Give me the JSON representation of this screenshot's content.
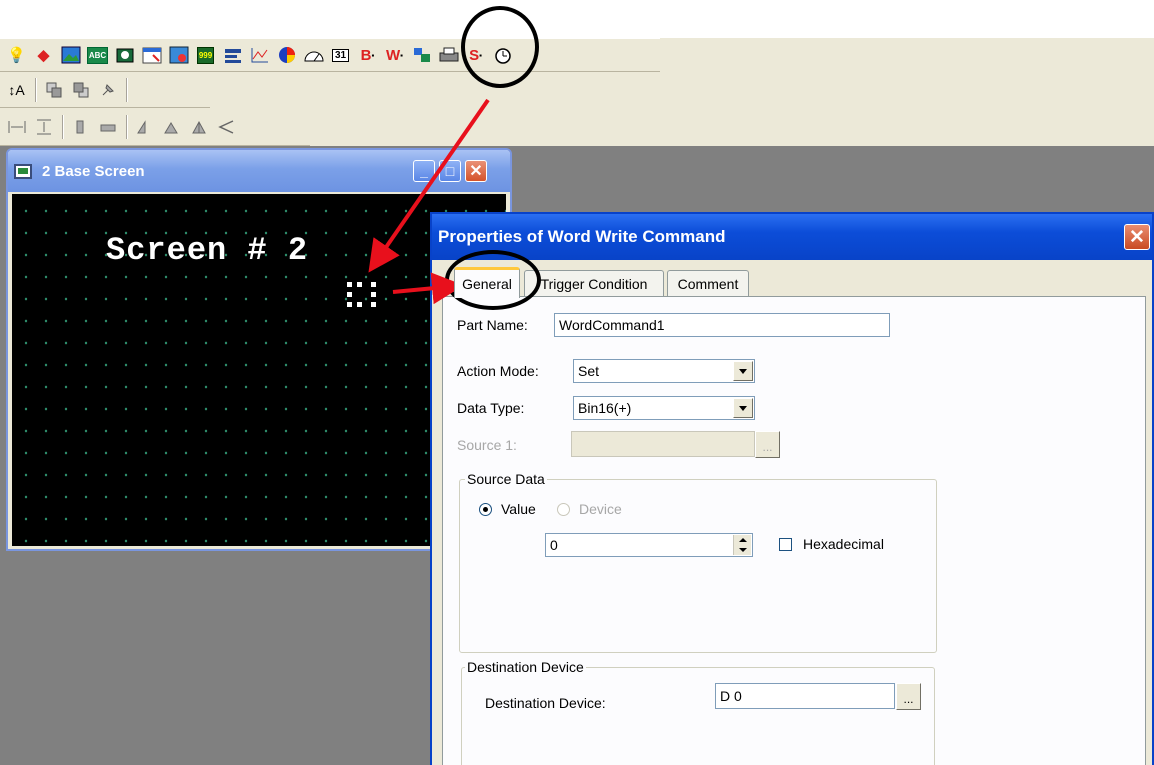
{
  "toolbar1": {
    "icons": [
      "lightbulb-icon",
      "palette-icon",
      "picture-icon",
      "text-abc-icon",
      "lamp-icon",
      "window-icon",
      "image-switch-icon",
      "numeric-999-icon",
      "bar-icon",
      "line-graph-icon",
      "pie-chart-icon",
      "meter-icon",
      "calendar-icon",
      "bit-switch-icon",
      "word-write-command-icon",
      "parts-icon",
      "printer-icon",
      "script-icon",
      "timer-icon"
    ],
    "text_icons": {
      "abc": "ABC",
      "num": "999",
      "cal": "31",
      "bit": "B",
      "word": "W",
      "script": "S"
    }
  },
  "toolbar2": {
    "icons": [
      "resize-text-icon",
      "front-icon",
      "back-icon",
      "pin-icon"
    ],
    "resize_label": "A"
  },
  "toolbar3": {
    "icons": [
      "align-width-icon",
      "align-height-icon",
      "align-left-icon",
      "align-center-icon",
      "align-top-icon",
      "align-middle-icon",
      "align-right-icon",
      "align-bottom-icon"
    ]
  },
  "base_window": {
    "title": "2  Base Screen",
    "min_glyph": "_",
    "max_glyph": "□",
    "close_glyph": "✕",
    "screen_label": "Screen # 2"
  },
  "dialog": {
    "title": "Properties of Word Write Command",
    "close_glyph": "✕",
    "tabs": [
      {
        "label": "General",
        "active": true
      },
      {
        "label": "Trigger Condition",
        "active": false
      },
      {
        "label": "Comment",
        "active": false
      }
    ],
    "part_name_label": "Part Name:",
    "part_name_value": "WordCommand1",
    "action_mode_label": "Action Mode:",
    "action_mode_value": "Set",
    "data_type_label": "Data Type:",
    "data_type_value": "Bin16(+)",
    "source1_label": "Source 1:",
    "source1_value": "",
    "ellipsis": "...",
    "source_data": {
      "group_label": "Source Data",
      "value_label": "Value",
      "device_label": "Device",
      "value": "0",
      "hex_label": "Hexadecimal",
      "hex_checked": false
    },
    "destination": {
      "group_label": "Destination Device",
      "field_label": "Destination Device:",
      "value": "D 0"
    }
  },
  "colors": {
    "annotation_arrow": "#e8101c",
    "dialog_title": "#0843c8",
    "workspace": "#808080",
    "canvas": "#000000"
  }
}
